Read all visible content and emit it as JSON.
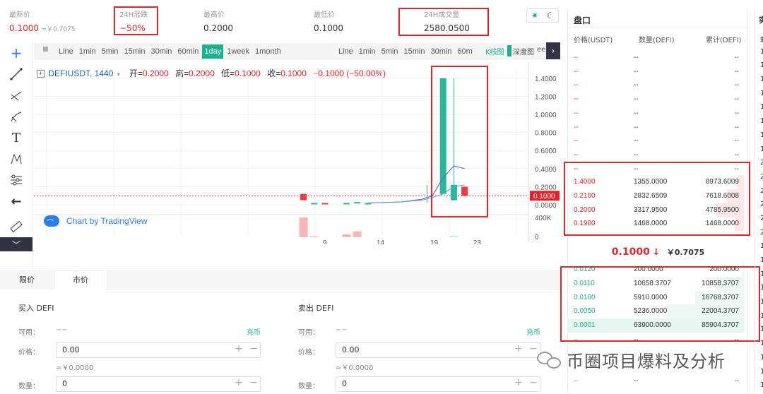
{
  "stats": [
    {
      "label": "最新价",
      "value": "0.1000",
      "sub": "≈￥0.7075",
      "color": "#e2242c"
    },
    {
      "label": "24H涨跌",
      "value": "−50%",
      "color": "#e2242c"
    },
    {
      "label": "最高价",
      "value": "0.2000"
    },
    {
      "label": "最低价",
      "value": "0.1000"
    },
    {
      "label": "24H成交量",
      "value": "2580.0500"
    }
  ],
  "theme_icons": [
    "sun-icon",
    "moon-icon"
  ],
  "toolbar_left": [
    "Line",
    "1min",
    "5min",
    "15min",
    "30min",
    "60min",
    "1day",
    "1week",
    "1month"
  ],
  "toolbar_left_active": "1day",
  "toolbar_right": [
    "Line",
    "1min",
    "5min",
    "15min",
    "30min",
    "60m"
  ],
  "toolbar_tabs": {
    "kline": "K线图",
    "depth": "深度图",
    "more": "ee"
  },
  "chart_header": {
    "symbol": "DEFIUSDT, 1440",
    "open_label": "开=",
    "open": "0.2000",
    "high_label": "高=",
    "high": "0.2000",
    "low_label": "低=",
    "low": "0.1000",
    "close_label": "收=",
    "close": "0.1000",
    "change": "−0.1000 (−50.00%)"
  },
  "watermark": "Chart by TradingView",
  "chart_data": {
    "type": "candlestick",
    "y_ticks": [
      "1.4000",
      "1.2000",
      "1.0000",
      "0.8000",
      "0.6000",
      "0.4000",
      "0.2000",
      "0.0000"
    ],
    "ylim": [
      0,
      1.5
    ],
    "current_price_label": "0.1000",
    "volume_tick": "400K",
    "volume_zero": "0",
    "x_ticks": [
      "9",
      "14",
      "19",
      "23"
    ],
    "candles": [
      {
        "day": 7,
        "open": 0.12,
        "close": 0.05,
        "high": 0.12,
        "low": 0.05
      },
      {
        "day": 8,
        "open": 0.02,
        "close": 0.02,
        "high": 0.02,
        "low": 0.02
      },
      {
        "day": 9,
        "open": 0.02,
        "close": 0.01,
        "high": 0.02,
        "low": 0.01
      },
      {
        "day": 11,
        "open": 0.02,
        "close": 0.02,
        "high": 0.02,
        "low": 0.02
      },
      {
        "day": 12,
        "open": 0.02,
        "close": 0.03,
        "high": 0.03,
        "low": 0.02
      },
      {
        "day": 13,
        "open": 0.02,
        "close": 0.02,
        "high": 0.02,
        "low": 0.02
      },
      {
        "day": 20,
        "open": 0.12,
        "close": 1.4,
        "high": 1.4,
        "low": 0.12
      },
      {
        "day": 21,
        "open": 0.05,
        "close": 0.22,
        "high": 1.4,
        "low": 0.05
      },
      {
        "day": 22,
        "open": 0.2,
        "close": 0.1,
        "high": 0.2,
        "low": 0.1
      }
    ],
    "volumes": [
      {
        "day": 7,
        "value": 200,
        "dir": "down"
      },
      {
        "day": 8,
        "value": 10,
        "dir": "down"
      },
      {
        "day": 11,
        "value": 30,
        "dir": "down"
      },
      {
        "day": 12,
        "value": 60,
        "dir": "down"
      },
      {
        "day": 21,
        "value": 10,
        "dir": "up"
      }
    ]
  },
  "orderbook": {
    "title": "盘口",
    "headers": [
      "价格(USDT)",
      "数量(DEFI)",
      "累计(DEFI)"
    ],
    "empty_rows": 9,
    "placeholder": "--",
    "asks": [
      {
        "price": "1.4000",
        "qty": "1355.0000",
        "total": "8973.6009"
      },
      {
        "price": "0.2100",
        "qty": "2832.6509",
        "total": "7618.6008"
      },
      {
        "price": "0.2000",
        "qty": "3317.9500",
        "total": "4785.9500"
      },
      {
        "price": "0.1900",
        "qty": "1468.0000",
        "total": "1468.0000"
      }
    ],
    "mid_price": "0.1000",
    "mid_arrow": "↓",
    "mid_cny": "￥0.7075",
    "bids": [
      {
        "price": "0.0120",
        "qty": "200.0000",
        "total": "200.0000"
      },
      {
        "price": "0.0110",
        "qty": "10658.3707",
        "total": "10858.3707"
      },
      {
        "price": "0.0100",
        "qty": "5910.0000",
        "total": "16768.3707"
      },
      {
        "price": "0.0050",
        "qty": "5236.0000",
        "total": "22004.3707"
      },
      {
        "price": "0.0001",
        "qty": "63900.0000",
        "total": "85904.3707"
      }
    ]
  },
  "right_edge": {
    "top_char": "实",
    "chars": [
      "时",
      "1",
      "1",
      "1",
      "1",
      "1",
      "1",
      "1",
      "1",
      "2",
      "2",
      "2",
      "2",
      "2",
      "2",
      "1",
      "1",
      "1",
      "1",
      "1",
      "1",
      "1",
      "1",
      "1",
      "1",
      "1"
    ]
  },
  "order_tabs": [
    "限价",
    "市价"
  ],
  "buy": {
    "title": "买入 DEFI",
    "available_label": "可用：",
    "available": "−−",
    "deposit": "充币",
    "price_label": "价格：",
    "price": "0.00",
    "approx": "≈￥0.0000",
    "amount_label": "数量：",
    "amount": "0"
  },
  "sell": {
    "title": "卖出 DEFI",
    "available_label": "可用：",
    "available": "−−",
    "deposit": "充币",
    "price_label": "价格：",
    "price": "0.00",
    "approx": "≈￥0.0000",
    "amount_label": "数量：",
    "amount": "0"
  },
  "wechat_watermark": "币圈项目爆料及分析"
}
